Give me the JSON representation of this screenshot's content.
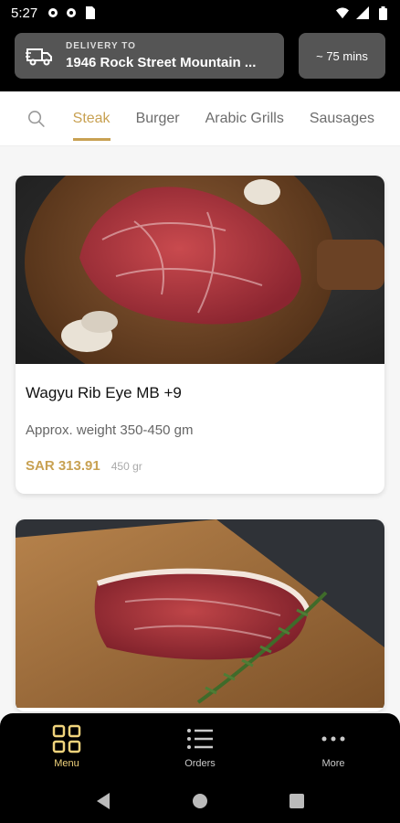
{
  "status": {
    "time": "5:27"
  },
  "delivery": {
    "label": "DELIVERY TO",
    "address": "1946 Rock Street Mountain ..."
  },
  "eta": {
    "text": "~ 75 mins"
  },
  "tabs": [
    "Steak",
    "Burger",
    "Arabic Grills",
    "Sausages"
  ],
  "active_tab": "Steak",
  "products": [
    {
      "name": "Wagyu Rib Eye MB +9",
      "description": "Approx. weight 350-450 gm",
      "price": "SAR 313.91",
      "weight": "450 gr"
    }
  ],
  "bottom_nav": {
    "menu": "Menu",
    "orders": "Orders",
    "more": "More"
  },
  "colors": {
    "accent": "#c8a152",
    "nav_active": "#f0d37c",
    "header_bg": "#000000",
    "card_bg": "#ffffff"
  },
  "icons": {
    "status_left": [
      "settings-icon",
      "settings-icon",
      "sim-card-icon"
    ],
    "status_right": [
      "wifi-icon",
      "signal-icon",
      "battery-icon"
    ],
    "delivery": "delivery-truck-icon",
    "search": "search-icon",
    "bottom_nav": [
      "grid-icon",
      "list-icon",
      "more-dots-icon"
    ]
  }
}
